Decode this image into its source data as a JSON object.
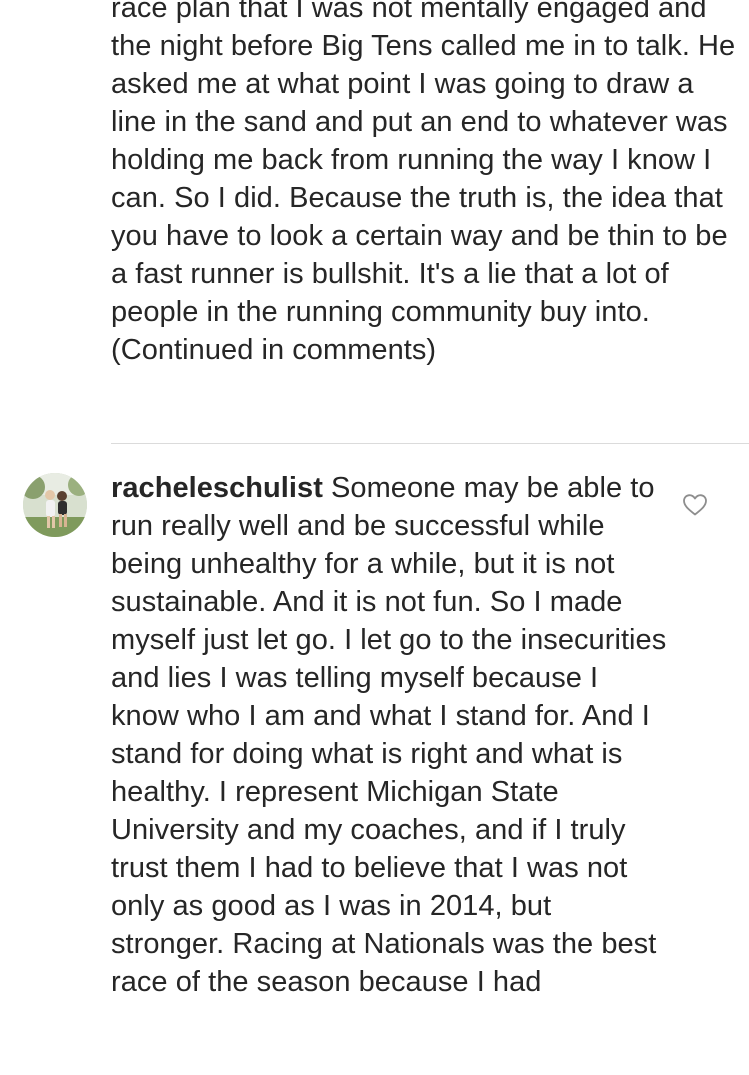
{
  "post": {
    "caption_text": "race plan that I was not mentally engaged and the night before Big Tens called me in to talk. He asked me at what point I was going to draw a line in the sand and put an end to whatever was holding me back from running the way I know I can. So I did. Because the truth is, the idea that you have to look a certain way and be thin to be a fast runner is bullshit. It's a lie that a lot of people in the running community buy into. (Continued in comments)"
  },
  "comment": {
    "username": "racheleschulist",
    "text": "Someone may be able to run really well and be successful while being unhealthy for a while, but it is not sustainable. And it is not fun. So I made myself just let go. I let go to the insecurities and lies I was telling myself because I know who I am and what I stand for. And I stand for doing what is right and what is healthy. I represent Michigan State University and my coaches, and if I truly trust them I had to believe that I was not only as good as I was in 2014, but stronger. Racing at Nationals was the best race of the season because I had",
    "like_icon": "heart-outline-icon"
  },
  "colors": {
    "text": "#262626",
    "divider": "#dbdbdb",
    "icon": "#8e8e8e"
  }
}
